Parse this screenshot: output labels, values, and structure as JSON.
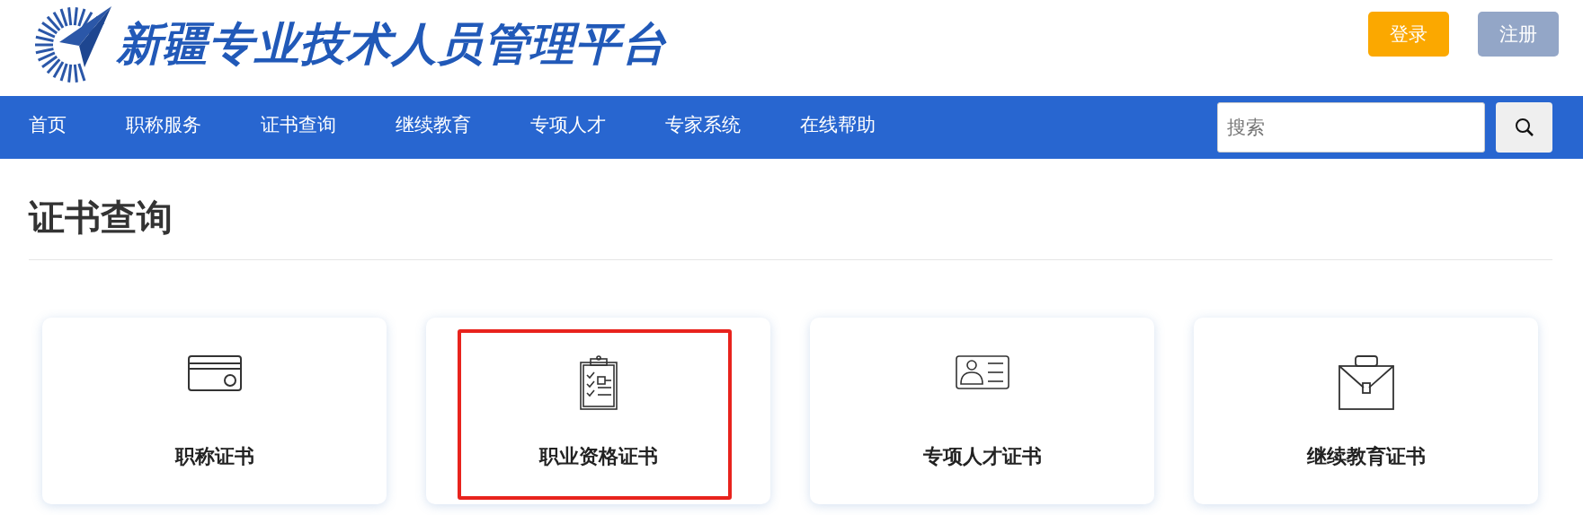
{
  "header": {
    "logo_text": "新疆专业技术人员管理平台",
    "buttons": [
      {
        "label": "登录",
        "kind": "primary"
      },
      {
        "label": "注册",
        "kind": "secondary"
      }
    ]
  },
  "nav": {
    "items": [
      {
        "label": "首页"
      },
      {
        "label": "职称服务"
      },
      {
        "label": "证书查询"
      },
      {
        "label": "继续教育"
      },
      {
        "label": "专项人才"
      },
      {
        "label": "专家系统"
      },
      {
        "label": "在线帮助"
      }
    ],
    "search": {
      "placeholder": "搜索"
    }
  },
  "page": {
    "title": "证书查询"
  },
  "cards": [
    {
      "label": "职称证书",
      "kind": "card",
      "highlighted": false
    },
    {
      "label": "职业资格证书",
      "kind": "clipboard",
      "highlighted": true
    },
    {
      "label": "专项人才证书",
      "kind": "id",
      "highlighted": false
    },
    {
      "label": "继续教育证书",
      "kind": "briefcase",
      "highlighted": false
    }
  ]
}
